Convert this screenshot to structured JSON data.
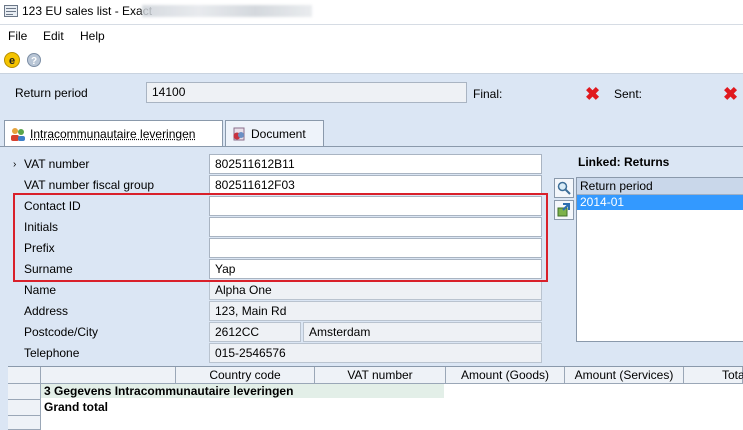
{
  "window": {
    "title": "123 EU sales list - Exact"
  },
  "menu": {
    "items": [
      "File",
      "Edit",
      "Help"
    ]
  },
  "toolbar": {
    "icons": [
      "exact-logo-icon",
      "help-icon"
    ]
  },
  "header": {
    "return_period_label": "Return period",
    "return_period_value": "14100",
    "final_label": "Final:",
    "sent_label": "Sent:"
  },
  "tabs": [
    {
      "label": "Intracommunautaire leveringen",
      "active": true
    },
    {
      "label": "Document",
      "active": false
    }
  ],
  "form": {
    "vat_number": {
      "label": "VAT number",
      "value": "802511612B11"
    },
    "vat_fiscal": {
      "label": "VAT number fiscal group",
      "value": "802511612F03"
    },
    "contact_id": {
      "label": "Contact ID",
      "value": ""
    },
    "initials": {
      "label": "Initials",
      "value": ""
    },
    "prefix": {
      "label": "Prefix",
      "value": ""
    },
    "surname": {
      "label": "Surname",
      "value": "Yap"
    },
    "name": {
      "label": "Name",
      "value": "Alpha One"
    },
    "address": {
      "label": "Address",
      "value": "123, Main Rd"
    },
    "postcode_city": {
      "label": "Postcode/City",
      "postcode": "2612CC",
      "city": "Amsterdam"
    },
    "telephone": {
      "label": "Telephone",
      "value": "015-2546576"
    }
  },
  "linked": {
    "title": "Linked: Returns",
    "column": "Return period",
    "rows": [
      "2014-01"
    ]
  },
  "grid": {
    "columns": [
      "Country code",
      "VAT number",
      "Amount (Goods)",
      "Amount (Services)",
      "Total"
    ],
    "rows": [
      "3 Gegevens Intracommunautaire leveringen",
      "Grand total"
    ]
  },
  "colors": {
    "accent": "#3399ff",
    "highlight": "#d9202a",
    "error": "#e0191e",
    "panel": "#dbe6f4"
  }
}
